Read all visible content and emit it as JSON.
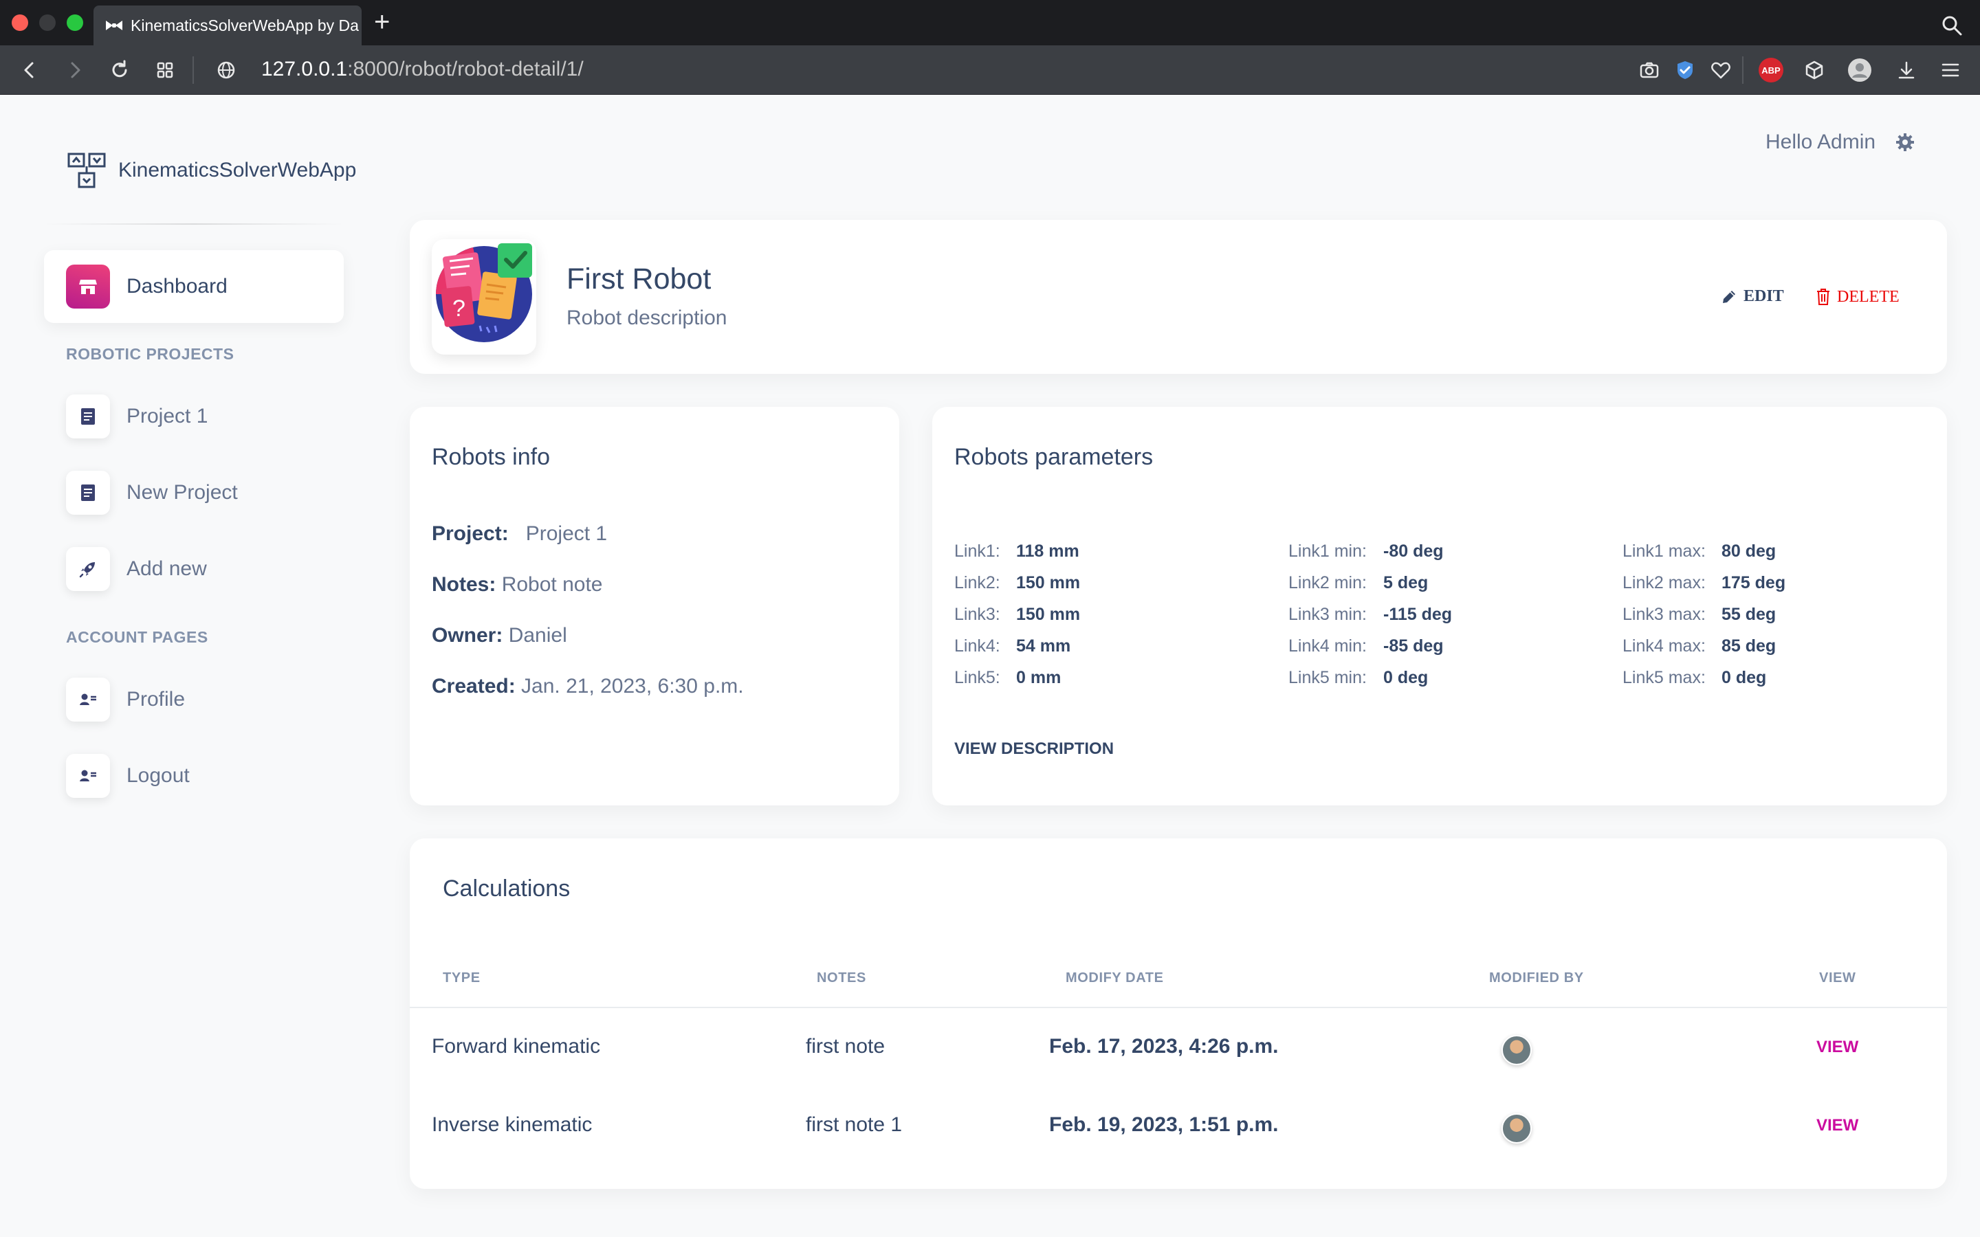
{
  "browser": {
    "tab_title": "KinematicsSolverWebApp by Da",
    "url_host": "127.0.0.1",
    "url_rest": ":8000/robot/robot-detail/1/"
  },
  "brand": {
    "title": "KinematicsSolverWebApp"
  },
  "header": {
    "greeting": "Hello Admin"
  },
  "sidebar": {
    "dashboard_label": "Dashboard",
    "section_projects": "ROBOTIC PROJECTS",
    "projects": [
      {
        "label": "Project 1"
      },
      {
        "label": "New Project"
      },
      {
        "label": "Add new"
      }
    ],
    "section_account": "ACCOUNT PAGES",
    "account": [
      {
        "label": "Profile"
      },
      {
        "label": "Logout"
      }
    ]
  },
  "robot": {
    "name": "First Robot",
    "description": "Robot description",
    "edit_label": "EDIT",
    "delete_label": "DELETE"
  },
  "info": {
    "title": "Robots info",
    "project_label": "Project:",
    "project_value": "Project 1",
    "notes_label": "Notes:",
    "notes_value": "Robot note",
    "owner_label": "Owner:",
    "owner_value": "Daniel",
    "created_label": "Created:",
    "created_value": "Jan. 21, 2023, 6:30 p.m."
  },
  "params": {
    "title": "Robots parameters",
    "rows": [
      {
        "link_label": "Link1:",
        "link_value": "118 mm",
        "min_label": "Link1 min:",
        "min_value": "-80 deg",
        "max_label": "Link1 max:",
        "max_value": "80 deg"
      },
      {
        "link_label": "Link2:",
        "link_value": "150 mm",
        "min_label": "Link2 min:",
        "min_value": "5 deg",
        "max_label": "Link2 max:",
        "max_value": "175 deg"
      },
      {
        "link_label": "Link3:",
        "link_value": "150 mm",
        "min_label": "Link3 min:",
        "min_value": "-115 deg",
        "max_label": "Link3 max:",
        "max_value": "55 deg"
      },
      {
        "link_label": "Link4:",
        "link_value": "54 mm",
        "min_label": "Link4 min:",
        "min_value": "-85 deg",
        "max_label": "Link4 max:",
        "max_value": "85 deg"
      },
      {
        "link_label": "Link5:",
        "link_value": "0 mm",
        "min_label": "Link5 min:",
        "min_value": "0 deg",
        "max_label": "Link5 max:",
        "max_value": "0 deg"
      }
    ],
    "view_description": "VIEW DESCRIPTION"
  },
  "calculations": {
    "title": "Calculations",
    "columns": [
      "TYPE",
      "NOTES",
      "MODIFY DATE",
      "MODIFIED BY",
      "VIEW"
    ],
    "rows": [
      {
        "type": "Forward kinematic",
        "notes": "first note",
        "date": "Feb. 17, 2023, 4:26 p.m.",
        "view": "VIEW"
      },
      {
        "type": "Inverse kinematic",
        "notes": "first note 1",
        "date": "Feb. 19, 2023, 1:51 p.m.",
        "view": "VIEW"
      }
    ]
  },
  "colors": {
    "primary_text": "#344767",
    "secondary_text": "#67748e",
    "accent_pink": "#cb0c9f",
    "danger": "#ea0606"
  }
}
